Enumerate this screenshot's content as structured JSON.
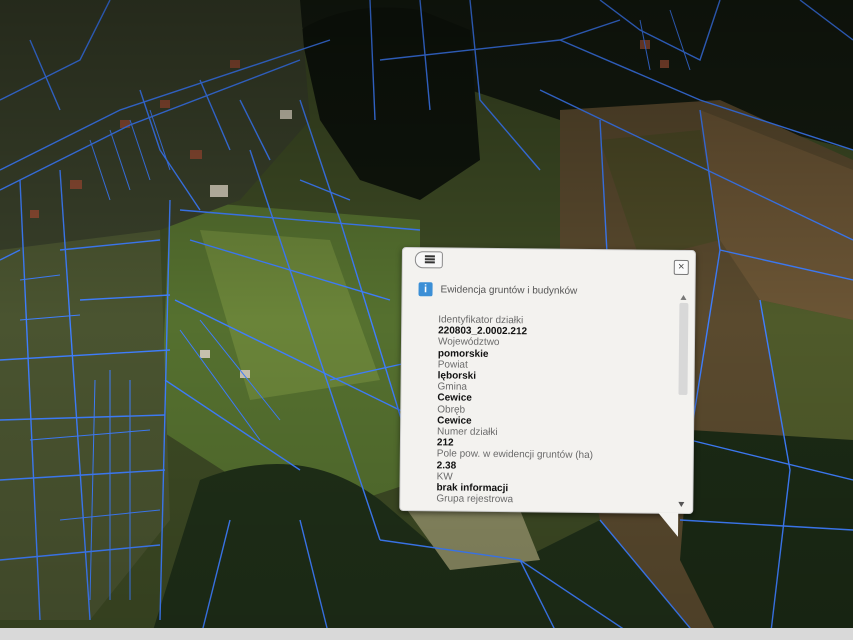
{
  "popup": {
    "title": "Ewidencja gruntów i budynków",
    "close_symbol": "×",
    "info_symbol": "i",
    "fields": [
      {
        "label": "Identyfikator działki",
        "value": "220803_2.0002.212"
      },
      {
        "label": "Województwo",
        "value": "pomorskie"
      },
      {
        "label": "Powiat",
        "value": "lęborski"
      },
      {
        "label": "Gmina",
        "value": "Cewice"
      },
      {
        "label": "Obręb",
        "value": "Cewice"
      },
      {
        "label": "Numer działki",
        "value": "212"
      },
      {
        "label": "Pole pow. w ewidencji gruntów (ha)",
        "value": "2.38"
      },
      {
        "label": "KW",
        "value": "brak informacji"
      },
      {
        "label": "Grupa rejestrowa",
        "value": ""
      }
    ]
  },
  "colors": {
    "parcel_line": "#3f7fff",
    "popup_bg": "#f3f2ef",
    "info_icon": "#3b8fd6"
  },
  "icons": {
    "back": "list-back-icon",
    "close": "close-icon",
    "info": "info-icon"
  }
}
